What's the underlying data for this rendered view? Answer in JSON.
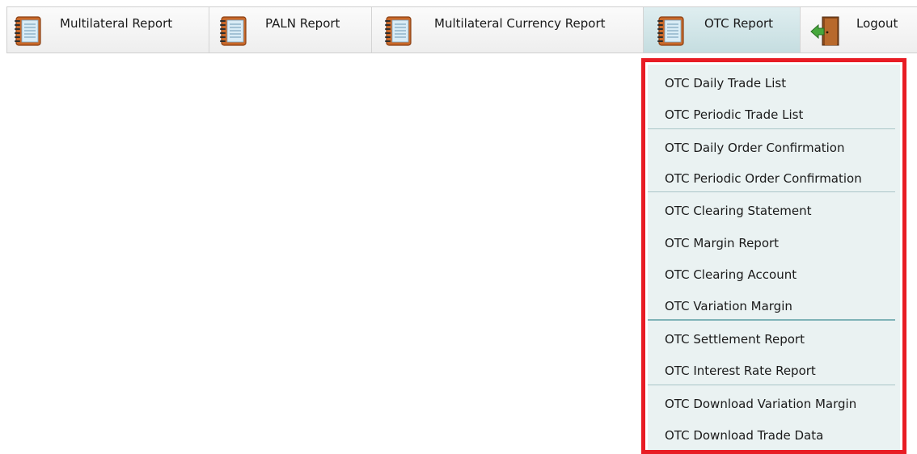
{
  "menubar": {
    "items": [
      {
        "label": "Multilateral Report",
        "icon": "notebook-icon"
      },
      {
        "label": "PALN Report",
        "icon": "notebook-icon"
      },
      {
        "label": "Multilateral Currency Report",
        "icon": "notebook-icon"
      },
      {
        "label": "OTC Report",
        "icon": "notebook-icon",
        "active": true
      },
      {
        "label": "Logout",
        "icon": "exit-door-icon"
      }
    ]
  },
  "otc_menu": {
    "items": [
      {
        "label": "OTC Daily Trade List"
      },
      {
        "label": "OTC Periodic Trade List"
      },
      {
        "label": "OTC Daily Order Confirmation"
      },
      {
        "label": "OTC Periodic Order Confirmation"
      },
      {
        "label": "OTC Clearing Statement"
      },
      {
        "label": "OTC Margin Report"
      },
      {
        "label": "OTC Clearing Account"
      },
      {
        "label": "OTC Variation Margin"
      },
      {
        "label": "OTC Settlement Report"
      },
      {
        "label": "OTC Interest Rate Report"
      },
      {
        "label": "OTC Download Variation Margin"
      },
      {
        "label": "OTC Download Trade Data"
      }
    ]
  },
  "colors": {
    "highlight_border": "#e81c24",
    "dropdown_bg": "#eaf2f2",
    "active_tab_bg": "#cfe4e6"
  }
}
